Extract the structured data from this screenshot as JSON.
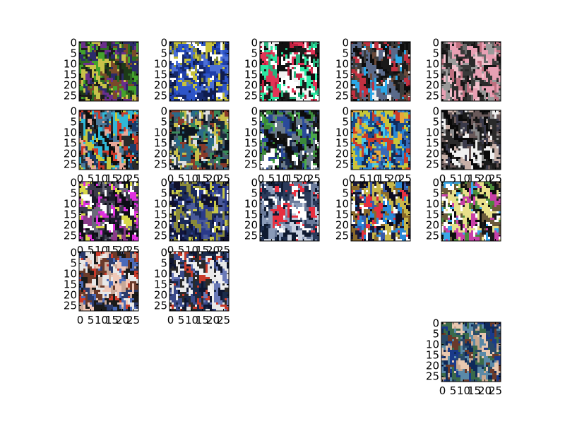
{
  "chart_data": {
    "type": "image_grid",
    "grid": {
      "rows": 5,
      "cols": 5
    },
    "image_shape": [
      28,
      28
    ],
    "xlim": [
      -0.5,
      27.5
    ],
    "ylim": [
      27.5,
      -0.5
    ],
    "yticks": [
      0,
      5,
      10,
      15,
      20,
      25
    ],
    "xticks": [
      0,
      5,
      10,
      15,
      20,
      25
    ],
    "panels": [
      {
        "row": 0,
        "col": 0,
        "x_ticks_shown": false,
        "palette": [
          "#2f6b22",
          "#44a22c",
          "#1d3a18",
          "#6b2f8c",
          "#c9c24a",
          "#2b2b6a",
          "#7a4a2a",
          "#1b1b1b"
        ]
      },
      {
        "row": 0,
        "col": 1,
        "x_ticks_shown": false,
        "palette": [
          "#1f3fa8",
          "#2d55c8",
          "#162a6e",
          "#c8c23a",
          "#ffffff",
          "#4b6fd6",
          "#0f1d4f",
          "#8a8f3a"
        ]
      },
      {
        "row": 0,
        "col": 2,
        "x_ticks_shown": false,
        "palette": [
          "#2ce8a2",
          "#e23456",
          "#1c1c1c",
          "#f2f2f2",
          "#28b47e",
          "#c21f3f",
          "#ffffff",
          "#101010"
        ]
      },
      {
        "row": 0,
        "col": 3,
        "x_ticks_shown": false,
        "palette": [
          "#1a1a1a",
          "#3b3b3b",
          "#6a4a3a",
          "#c23040",
          "#2aa8e8",
          "#f0f0f0",
          "#5a6a8a",
          "#0d0d0d"
        ]
      },
      {
        "row": 0,
        "col": 4,
        "x_ticks_shown": false,
        "palette": [
          "#3a3a3a",
          "#e8a0b4",
          "#6a6a6a",
          "#c07080",
          "#2a2a2a",
          "#9a9a9a",
          "#f2c0cc",
          "#151515"
        ]
      },
      {
        "row": 1,
        "col": 0,
        "x_ticks_shown": true,
        "palette": [
          "#1a3a6a",
          "#30b8d8",
          "#e8a898",
          "#2a2a2a",
          "#cc3a2a",
          "#c8c83a",
          "#4a7a9a",
          "#0f0f0f"
        ]
      },
      {
        "row": 1,
        "col": 1,
        "x_ticks_shown": true,
        "palette": [
          "#1a2a3a",
          "#4a5a6a",
          "#c8c04a",
          "#2a6a8a",
          "#e0e0e0",
          "#8a3a2a",
          "#3a8a5a",
          "#0d1520"
        ]
      },
      {
        "row": 1,
        "col": 2,
        "x_ticks_shown": true,
        "palette": [
          "#1a2a4a",
          "#3a8a3a",
          "#ffffff",
          "#2a4a9a",
          "#0d0d0d",
          "#6a7a8a",
          "#4aa84a",
          "#1a1a1a"
        ]
      },
      {
        "row": 1,
        "col": 3,
        "x_ticks_shown": true,
        "palette": [
          "#1a4a8a",
          "#2a8ad8",
          "#c8c83a",
          "#cc3a2a",
          "#3a6ab8",
          "#0f2a5a",
          "#e8a83a",
          "#4ac8e8"
        ]
      },
      {
        "row": 1,
        "col": 4,
        "x_ticks_shown": true,
        "palette": [
          "#1a1a1a",
          "#2a2a2a",
          "#6a5a5a",
          "#c8b0a8",
          "#f0f0f0",
          "#3a3a4a",
          "#0a0a0a",
          "#8a8a8a"
        ]
      },
      {
        "row": 2,
        "col": 0,
        "x_ticks_shown": true,
        "palette": [
          "#1a1a2a",
          "#e030e0",
          "#3a3a4a",
          "#d8d84a",
          "#6a6a7a",
          "#ffffff",
          "#0d0d15",
          "#8a3a8a"
        ]
      },
      {
        "row": 2,
        "col": 1,
        "x_ticks_shown": true,
        "palette": [
          "#1a2a5a",
          "#c8c84a",
          "#2a3a8a",
          "#0f1540",
          "#ffffff",
          "#4a5a9a",
          "#8a8a3a",
          "#10102a"
        ]
      },
      {
        "row": 2,
        "col": 2,
        "x_ticks_shown": false,
        "palette": [
          "#6a7a9a",
          "#2a3a5a",
          "#c8d0e0",
          "#1a2a4a",
          "#e83040",
          "#8a9ab8",
          "#0f1a30",
          "#ffffff"
        ]
      },
      {
        "row": 2,
        "col": 3,
        "x_ticks_shown": false,
        "palette": [
          "#1a1a3a",
          "#c8b84a",
          "#e83040",
          "#3a5aa8",
          "#ffffff",
          "#0d0d20",
          "#8a6a2a",
          "#2a8ad8"
        ]
      },
      {
        "row": 2,
        "col": 4,
        "x_ticks_shown": false,
        "palette": [
          "#1a1a1a",
          "#e8e08a",
          "#3aa8e8",
          "#c840a8",
          "#4a8a3a",
          "#ffffff",
          "#6a5a3a",
          "#0d0d0d"
        ]
      },
      {
        "row": 3,
        "col": 0,
        "x_ticks_shown": true,
        "palette": [
          "#6a3a2a",
          "#e8e8e8",
          "#2a3a6a",
          "#c8a898",
          "#1a1a1a",
          "#cc3a2a",
          "#4a6ab8",
          "#f0c8b8"
        ]
      },
      {
        "row": 3,
        "col": 1,
        "x_ticks_shown": true,
        "palette": [
          "#1a2a4a",
          "#3a4a8a",
          "#e8e8e8",
          "#c83a2a",
          "#0d1530",
          "#6a7ab8",
          "#2a2a2a",
          "#f0f0f0"
        ]
      },
      {
        "row": 4,
        "col": 4,
        "x_ticks_shown": true,
        "palette": [
          "#1a3a8a",
          "#2a4a6a",
          "#c8a890",
          "#3a6a4a",
          "#5a8aa8",
          "#6a3a2a",
          "#0f2a5a",
          "#e8c8b0"
        ]
      }
    ]
  }
}
